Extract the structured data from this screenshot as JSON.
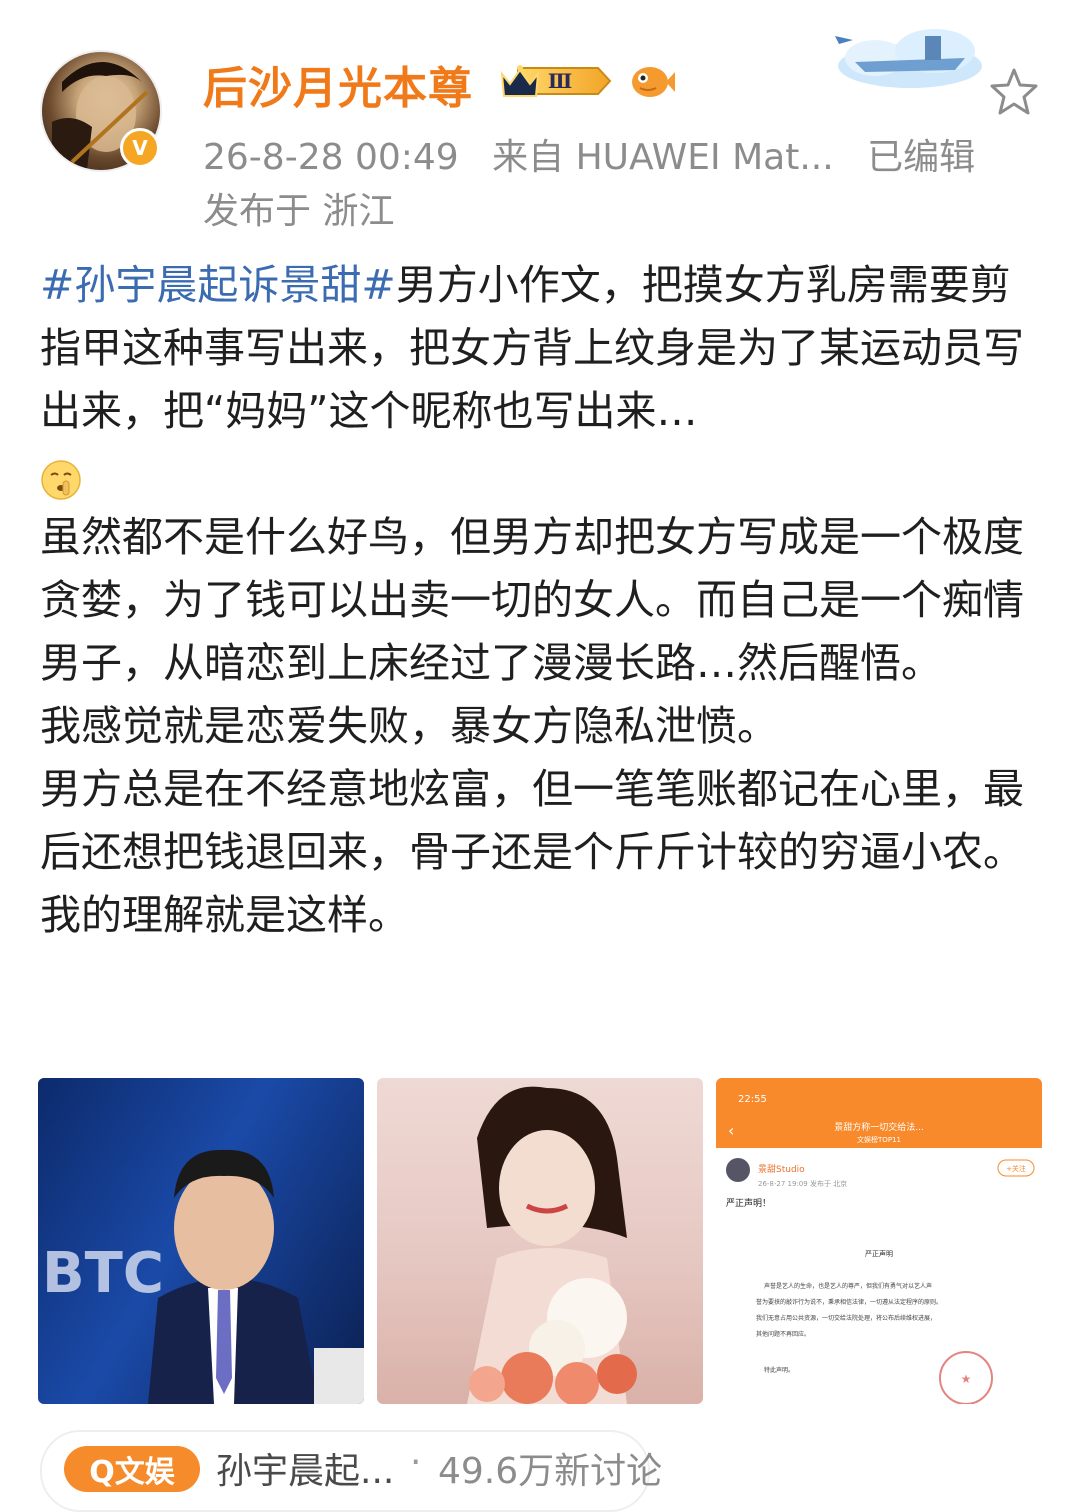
{
  "header": {
    "username": "后沙月光本尊",
    "level_badge": "Ⅲ",
    "verified_mark": "V",
    "timestamp": "26-8-28 00:49",
    "source": "来自 HUAWEI Mat...",
    "edited": "已编辑",
    "location": "发布于 浙江"
  },
  "post": {
    "hashtag": "#孙宇晨起诉景甜#",
    "para1_rest": "男方小作文，把摸女方乳房需要剪指甲这种事写出来，把女方背上纹身是为了某运动员写出来，把“妈妈”这个昵称也写出来…",
    "para2": "虽然都不是什么好鸟，但男方却把女方写成是一个极度贪婪，为了钱可以出卖一切的女人。而自己是一个痴情男子，从暗恋到上床经过了漫漫长路…然后醒悟。",
    "para3": "我感觉就是恋爱失败，暴女方隐私泄愤。",
    "para4": "男方总是在不经意地炫富，但一笔笔账都记在心里，最后还想把钱退回来，骨子还是个斤斤计较的穷逼小农。",
    "para5": "我的理解就是这样。"
  },
  "images": {
    "img1_text": "BTC",
    "img3": {
      "time": "22:55",
      "topbar_title": "景甜方称一切交给法...",
      "topbar_sub": "文娱榜TOP11",
      "account": "景甜Studio",
      "follow": "+关注",
      "meta": "26-8-27 19:09  发布于 北京",
      "headline": "严正声明！",
      "doc_title": "严正声明",
      "doc_lines": [
        "声誉是艺人的生命，也是艺人的尊严，但我们有勇气对以艺人声",
        "誉为要挟的敲诈行为说不，秉承相信法律，一切遵从法定程序的原则。",
        "我们无意占用公共资源，一切交给法院处理，将公布后续维权进展，",
        "其他问题不再回应。"
      ],
      "doc_end": "特此声明。"
    }
  },
  "topic": {
    "tag": "Q文娱",
    "name": "孙宇晨起...",
    "dot": "·",
    "discussions": "49.6万新讨论"
  },
  "colors": {
    "username": "#f07a1a",
    "hashtag": "#3b6bb0",
    "meta": "#8c8c8c",
    "tag_bg": "#f68b2c"
  },
  "icons": {
    "star": "star-icon",
    "crown": "crown-icon",
    "fish": "fish-icon",
    "emoji": "shushing-face-icon"
  }
}
